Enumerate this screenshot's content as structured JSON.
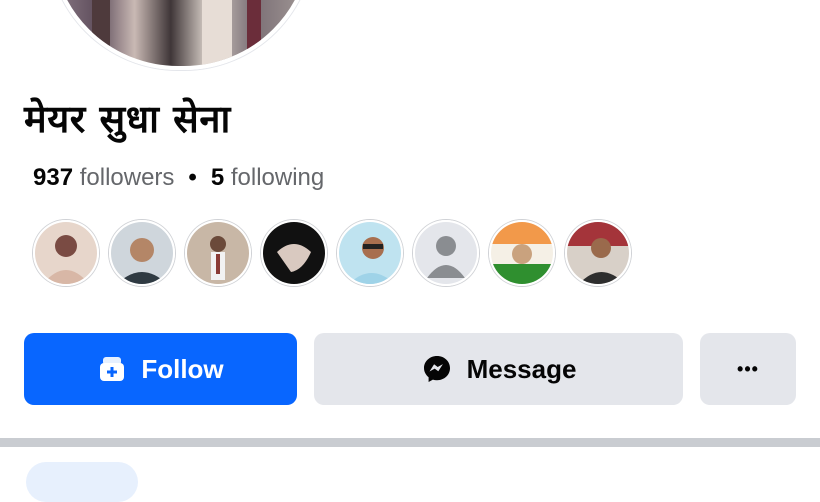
{
  "profile": {
    "name": "मेयर सुधा सेना",
    "followers_count": "937",
    "followers_label": "followers",
    "separator": "•",
    "following_count": "5",
    "following_label": "following"
  },
  "friend_avatars": [
    {
      "name": "friend-avatar-1",
      "colors": [
        "#d8b7a6",
        "#7a4b43"
      ]
    },
    {
      "name": "friend-avatar-2",
      "colors": [
        "#2f3a42",
        "#b48667"
      ]
    },
    {
      "name": "friend-avatar-3",
      "colors": [
        "#c8b7a6",
        "#8a3b35"
      ]
    },
    {
      "name": "friend-avatar-4",
      "colors": [
        "#111111",
        "#d9c9c0"
      ]
    },
    {
      "name": "friend-avatar-5",
      "colors": [
        "#9fd3e8",
        "#2f7d66"
      ]
    },
    {
      "name": "friend-avatar-6",
      "colors": [
        "#e4e6eb",
        "#8a8d91"
      ]
    },
    {
      "name": "friend-avatar-7",
      "colors": [
        "#f2994a",
        "#2f8f2f"
      ]
    },
    {
      "name": "friend-avatar-8",
      "colors": [
        "#a4343a",
        "#2e2e2e"
      ]
    }
  ],
  "actions": {
    "follow_label": "Follow",
    "message_label": "Message",
    "more_label": "•••",
    "follow_icon": "follow-add-icon",
    "message_icon": "messenger-icon"
  },
  "colors": {
    "primary": "#0866ff",
    "secondary_bg": "#e4e6eb",
    "muted_text": "#65676b"
  }
}
